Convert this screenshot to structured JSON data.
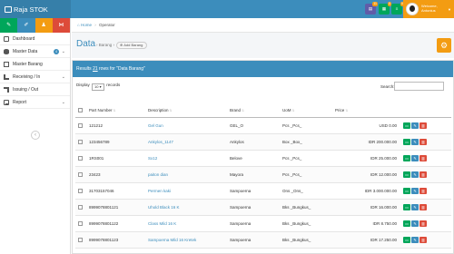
{
  "app": {
    "title": "Raja STOK"
  },
  "topbar": {
    "badges": [
      {
        "icon": "folder-icon",
        "count": "11",
        "color": "#605ca8"
      },
      {
        "icon": "cart-icon",
        "count": "0",
        "color": "#00a65a"
      },
      {
        "icon": "list-icon",
        "count": "0",
        "color": "#00a65a"
      }
    ],
    "user": {
      "greeting": "Welcome,",
      "name": "Antonius"
    }
  },
  "sidebar": {
    "quick": [
      {
        "icon": "pencil-icon",
        "color": "#00a65a"
      },
      {
        "icon": "edit-icon",
        "color": "#3c8dbc"
      },
      {
        "icon": "users-icon",
        "color": "#f39c12"
      },
      {
        "icon": "share-icon",
        "color": "#dd4b39"
      }
    ],
    "items": [
      {
        "label": "Dashboard",
        "icon": "dashboard-icon"
      },
      {
        "label": "Master Data",
        "icon": "database-icon",
        "badge": "4"
      },
      {
        "label": "Master Barang",
        "icon": "box-icon"
      },
      {
        "label": "Receiving / In",
        "icon": "receive-icon"
      },
      {
        "label": "Issuing / Out",
        "icon": "issue-icon"
      },
      {
        "label": "Report",
        "icon": "report-icon"
      }
    ]
  },
  "breadcrumb": {
    "home": "Home",
    "current": "Operator"
  },
  "header": {
    "title": "Data",
    "subtitle": "Barang",
    "add_label": "Add Barang"
  },
  "panel": {
    "results_prefix": "Results ",
    "results_count": "21",
    "results_suffix": " rows for \"Data Barang\"",
    "display_label": "Display",
    "display_value": "10",
    "records_label": "records",
    "search_label": "Search:",
    "search_value": ""
  },
  "table": {
    "columns": [
      "Part Number",
      "Description",
      "Brand",
      "UoM",
      "Price"
    ],
    "rows": [
      {
        "part": "121212",
        "desc": "Gel Gun",
        "brand": "GEL_O",
        "uom": "Pcs _Pcs_",
        "price": "USD 0.00"
      },
      {
        "part": "123456789",
        "desc": "Ankylos_1147",
        "brand": "Ankylos",
        "uom": "Box _Box_",
        "price": "IDR 200.000.00"
      },
      {
        "part": "1RS001",
        "desc": "Sx12",
        "brand": "Belove",
        "uom": "Pcs _Pcs_",
        "price": "IDR 25.000.00"
      },
      {
        "part": "23423",
        "desc": "paiton dian",
        "brand": "Mayora",
        "uom": "Pcs _Pcs_",
        "price": "IDR 12.000.00"
      },
      {
        "part": "31703157046",
        "desc": "Permen kaki",
        "brand": "Sampoerna",
        "uom": "Ons _Ons_",
        "price": "IDR 3.000.000.00"
      },
      {
        "part": "8999078801121",
        "desc": "Uhold Black 16 K",
        "brand": "Sampoerna",
        "uom": "Bks _Bungkus_",
        "price": "IDR 16.000.00"
      },
      {
        "part": "8999078801122",
        "desc": "Class Mild 16 K",
        "brand": "Sampoerna",
        "uom": "Bks _Bungkus_",
        "price": "IDR 8.750.00"
      },
      {
        "part": "8999078801123",
        "desc": "Sampoerna Mild 16 Kretek",
        "brand": "Sampoerna",
        "uom": "Bks _Bungkus_",
        "price": "IDR 17.250.00"
      }
    ]
  }
}
